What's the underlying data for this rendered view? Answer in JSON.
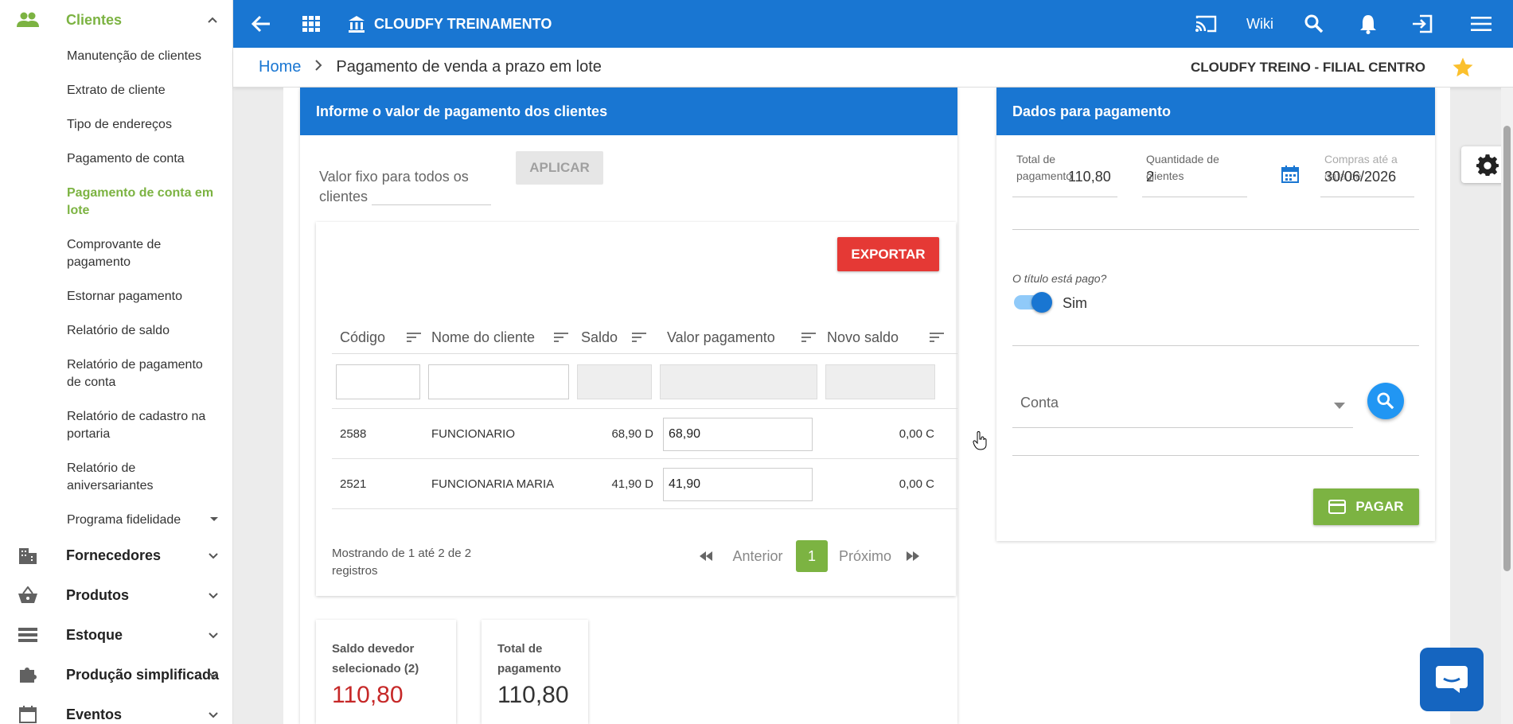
{
  "sidebar": {
    "active_group": "Clientes",
    "items": [
      {
        "label": "Manutenção de clientes"
      },
      {
        "label": "Extrato de cliente"
      },
      {
        "label": "Tipo de endereços"
      },
      {
        "label": "Pagamento de conta"
      },
      {
        "label": "Pagamento de conta em lote"
      },
      {
        "label": "Comprovante de pagamento"
      },
      {
        "label": "Estornar pagamento"
      },
      {
        "label": "Relatório de saldo"
      },
      {
        "label": "Relatório de pagamento de conta"
      },
      {
        "label": "Relatório de cadastro na portaria"
      },
      {
        "label": "Relatório de aniversariantes"
      },
      {
        "label": "Programa fidelidade"
      }
    ],
    "groups": [
      {
        "label": "Fornecedores",
        "icon": "building-icon"
      },
      {
        "label": "Produtos",
        "icon": "basket-icon"
      },
      {
        "label": "Estoque",
        "icon": "storage-icon"
      },
      {
        "label": "Produção simplificada",
        "icon": "puzzle-icon"
      },
      {
        "label": "Eventos",
        "icon": "calendar-icon"
      }
    ]
  },
  "topbar": {
    "title": "CLOUDFY TREINAMENTO",
    "wiki": "Wiki"
  },
  "breadcrumb": {
    "home": "Home",
    "current": "Pagamento de venda a prazo em lote",
    "branch": "CLOUDFY TREINO - FILIAL CENTRO"
  },
  "left_panel": {
    "title": "Informe o valor de pagamento dos clientes",
    "fixed_value_label": "Valor fixo para todos os clientes",
    "apply_button": "APLICAR",
    "export_button": "EXPORTAR",
    "columns": [
      "Código",
      "Nome do cliente",
      "Saldo",
      "Valor pagamento",
      "Novo saldo"
    ],
    "rows": [
      {
        "code": "2588",
        "name": "FUNCIONARIO",
        "balance": "68,90 D",
        "payment": "68,90",
        "new_balance": "0,00 C"
      },
      {
        "code": "2521",
        "name": "FUNCIONARIA MARIA",
        "balance": "41,90 D",
        "payment": "41,90",
        "new_balance": "0,00 C"
      }
    ],
    "pager": {
      "info": "Mostrando de 1 até 2 de 2 registros",
      "prev": "Anterior",
      "page": "1",
      "next": "Próximo"
    },
    "stats": [
      {
        "label": "Saldo devedor selecionado (2)",
        "value": "110,80",
        "color": "#c62828"
      },
      {
        "label": "Total de pagamento",
        "value": "110,80",
        "color": "#333333"
      }
    ]
  },
  "right_panel": {
    "title": "Dados para pagamento",
    "total_label": "Total de pagamento",
    "total_value": "110,80",
    "qty_label": "Quantidade de clientes",
    "qty_value": "2",
    "date_label": "Compras até a data de",
    "date_value": "30/06/2026",
    "paid_question": "O título está pago?",
    "paid_toggle_label": "Sim",
    "account_label": "Conta",
    "pay_button": "PAGAR"
  },
  "colors": {
    "primary": "#1976d2",
    "accent_green": "#7cb342",
    "danger": "#e53935"
  }
}
